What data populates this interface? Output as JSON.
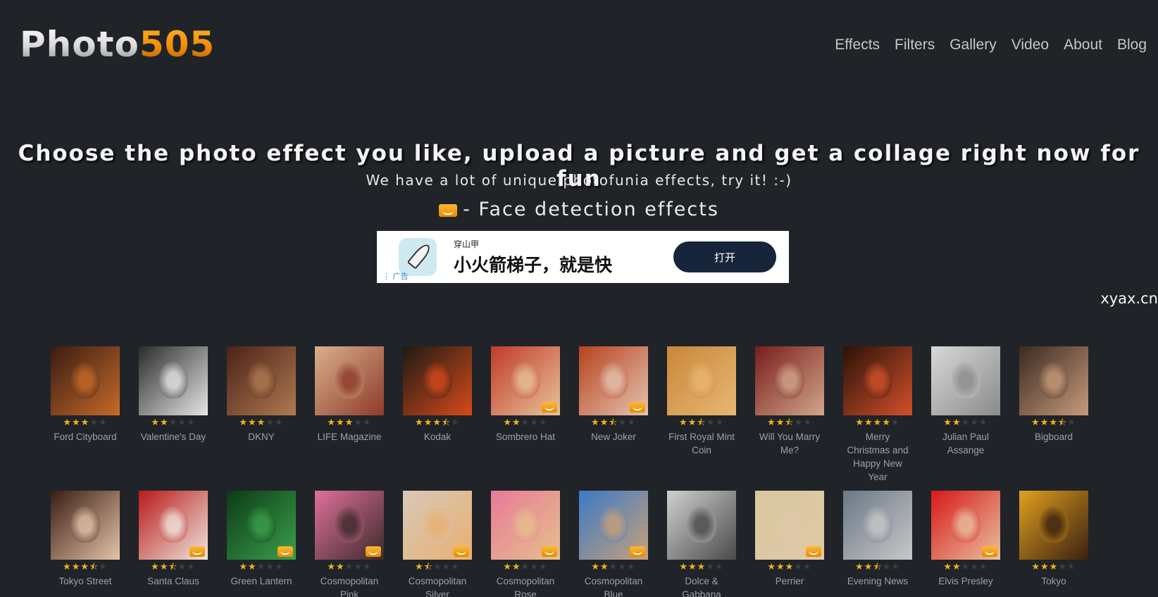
{
  "header": {
    "logo_part1": "Photo",
    "logo_part2": "505",
    "nav": [
      "Effects",
      "Filters",
      "Gallery",
      "Video",
      "About",
      "Blog"
    ]
  },
  "hero": {
    "title": "Choose the photo effect you like, upload a picture and get a collage right now for fun",
    "subtitle": "We have a lot of unique photofunia effects, try it! :-)",
    "face_detection": "- Face detection effects"
  },
  "ad": {
    "small": "穿山甲",
    "headline": "小火箭梯子，就是快",
    "button": "打开",
    "mark": "广告"
  },
  "watermark": "xyax.cn",
  "colors": {
    "background": "#202328",
    "accent": "#f0a020",
    "star": "#f0b41a",
    "caption": "#9da1a6"
  },
  "effects": [
    [
      {
        "name": "Ford Cityboard",
        "rating": 3,
        "face": false,
        "bg": "#3a1c12",
        "c2": "#c56a2a"
      },
      {
        "name": "Valentine's Day",
        "rating": 2,
        "face": false,
        "bg": "#2b2b2b",
        "c2": "#e6e6e6"
      },
      {
        "name": "DKNY",
        "rating": 3,
        "face": false,
        "bg": "#4a2218",
        "c2": "#b07a50"
      },
      {
        "name": "LIFE Magazine",
        "rating": 3,
        "face": false,
        "bg": "#d9b08c",
        "c2": "#8e3a2a"
      },
      {
        "name": "Kodak",
        "rating": 3.5,
        "face": false,
        "bg": "#1e1a14",
        "c2": "#d64a1a"
      },
      {
        "name": "Sombrero Hat",
        "rating": 2,
        "face": true,
        "bg": "#c23a2a",
        "c2": "#e7c39a"
      },
      {
        "name": "New Joker",
        "rating": 2.5,
        "face": true,
        "bg": "#b8421f",
        "c2": "#e4c4b0"
      },
      {
        "name": "First Royal Mint Coin",
        "rating": 2.5,
        "face": false,
        "bg": "#c9873a",
        "c2": "#e8b773"
      },
      {
        "name": "Will You Marry Me?",
        "rating": 2.5,
        "face": false,
        "bg": "#7a1c1c",
        "c2": "#d0a78a"
      },
      {
        "name": "Merry Christmas and Happy New Year",
        "rating": 4,
        "face": false,
        "bg": "#2a1208",
        "c2": "#d2502a"
      },
      {
        "name": "Julian Paul Assange",
        "rating": 2,
        "face": false,
        "bg": "#d8d8d8",
        "c2": "#8a8a8a"
      },
      {
        "name": "Bigboard",
        "rating": 3.5,
        "face": false,
        "bg": "#3a2a22",
        "c2": "#c89a7a"
      }
    ],
    [
      {
        "name": "Tokyo Street",
        "rating": 3.5,
        "face": false,
        "bg": "#3a1e14",
        "c2": "#e6c2a8"
      },
      {
        "name": "Santa Claus",
        "rating": 2.5,
        "face": true,
        "bg": "#b81a1a",
        "c2": "#f0e6de"
      },
      {
        "name": "Green Lantern",
        "rating": 2,
        "face": true,
        "bg": "#0e3a18",
        "c2": "#3aa04a"
      },
      {
        "name": "Cosmopolitan Pink",
        "rating": 2,
        "face": true,
        "bg": "#e0709a",
        "c2": "#3a2a2a"
      },
      {
        "name": "Cosmopolitan Silver",
        "rating": 1.5,
        "face": true,
        "bg": "#d8c8b8",
        "c2": "#e8b070"
      },
      {
        "name": "Cosmopolitan Rose",
        "rating": 2,
        "face": true,
        "bg": "#e87a9a",
        "c2": "#e6c08a"
      },
      {
        "name": "Cosmopolitan Blue",
        "rating": 2,
        "face": true,
        "bg": "#3a7ac8",
        "c2": "#c8a078"
      },
      {
        "name": "Dolce & Gabbana",
        "rating": 3,
        "face": false,
        "bg": "#d0d0d0",
        "c2": "#4a4a4a"
      },
      {
        "name": "Perrier",
        "rating": 3,
        "face": true,
        "bg": "#d8c8a0",
        "c2": "#e0c8a8"
      },
      {
        "name": "Evening News",
        "rating": 2.5,
        "face": false,
        "bg": "#6a7888",
        "c2": "#c8c8c8"
      },
      {
        "name": "Elvis Presley",
        "rating": 2,
        "face": true,
        "bg": "#d81818",
        "c2": "#e8c0a0"
      },
      {
        "name": "Tokyo",
        "rating": 3,
        "face": false,
        "bg": "#e0a020",
        "c2": "#3a2010"
      }
    ]
  ]
}
